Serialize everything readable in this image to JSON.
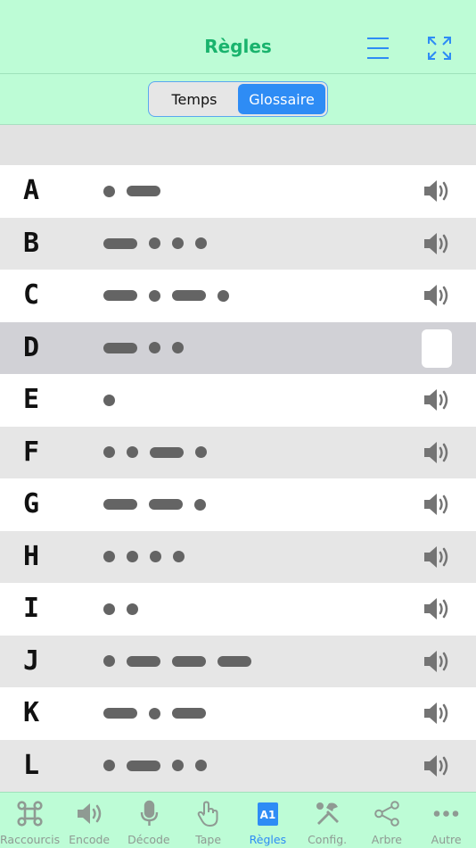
{
  "header": {
    "title": "Règles"
  },
  "segmented": {
    "options": [
      "Temps",
      "Glossaire"
    ],
    "selected": "Glossaire"
  },
  "glossary": [
    {
      "letter": "A",
      "code": ".-"
    },
    {
      "letter": "B",
      "code": "-..."
    },
    {
      "letter": "C",
      "code": "-.-."
    },
    {
      "letter": "D",
      "code": "-..",
      "selected": true
    },
    {
      "letter": "E",
      "code": "."
    },
    {
      "letter": "F",
      "code": "..-."
    },
    {
      "letter": "G",
      "code": "--."
    },
    {
      "letter": "H",
      "code": "...."
    },
    {
      "letter": "I",
      "code": ".."
    },
    {
      "letter": "J",
      "code": ".---"
    },
    {
      "letter": "K",
      "code": "-.-"
    },
    {
      "letter": "L",
      "code": ".-.."
    }
  ],
  "tabbar": {
    "items": [
      {
        "label": "Raccourcis",
        "icon": "command-icon"
      },
      {
        "label": "Encode",
        "icon": "speaker-icon"
      },
      {
        "label": "Décode",
        "icon": "microphone-icon"
      },
      {
        "label": "Tape",
        "icon": "hand-tap-icon"
      },
      {
        "label": "Règles",
        "icon": "rules-book-icon",
        "active": true
      },
      {
        "label": "Config.",
        "icon": "tools-icon"
      },
      {
        "label": "Arbre",
        "icon": "share-tree-icon"
      },
      {
        "label": "Autre",
        "icon": "more-icon"
      }
    ]
  },
  "colors": {
    "accent_green": "#19b36d",
    "header_bg": "#bdfcd6",
    "active_blue": "#2e8cf5",
    "morse_gray": "#646464"
  }
}
